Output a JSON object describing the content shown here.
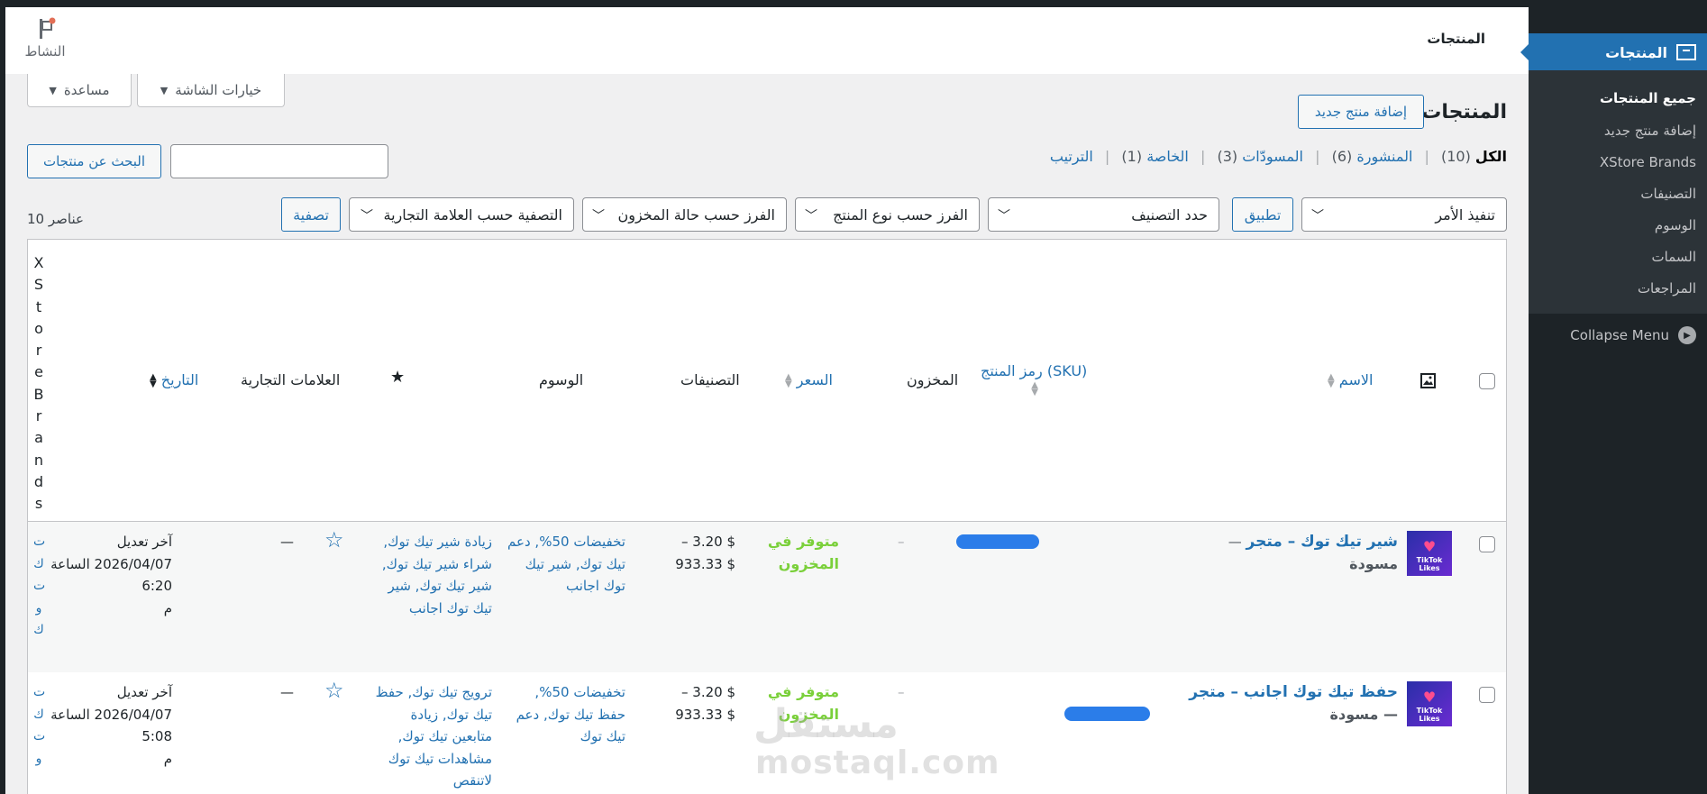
{
  "header": {
    "title": "المنتجات",
    "activity_label": "النشاط"
  },
  "tabs": {
    "screen_options": "خيارات الشاشة",
    "help": "مساعدة"
  },
  "page": {
    "title": "المنتجات",
    "add_new": "إضافة منتج جديد"
  },
  "views": {
    "all": "الكل",
    "all_count": "(10)",
    "published": "المنشورة",
    "published_count": "(6)",
    "drafts": "المسودّات",
    "drafts_count": "(3)",
    "private": "الخاصة",
    "private_count": "(1)",
    "sorting": "الترتيب"
  },
  "search": {
    "button": "البحث عن منتجات",
    "value": ""
  },
  "filters": {
    "bulk_action": "تنفيذ الأمر",
    "apply": "تطبيق",
    "category": "حدد التصنيف",
    "product_type": "الفرز حسب نوع المنتج",
    "stock_status": "الفرز حسب حالة المخزون",
    "brand": "التصفية حسب العلامة التجارية",
    "filter": "تصفية",
    "items_count": "10 عناصر"
  },
  "columns": {
    "image_icon": "image-icon",
    "name": "الاسم",
    "sku": "رمز المنتج (SKU)",
    "stock": "المخزون",
    "price": "السعر",
    "categories": "التصنيفات",
    "tags": "الوسوم",
    "featured_icon": "star-icon",
    "brands": "العلامات التجارية",
    "date": "التاريخ",
    "xstore_brands_vertical": "XStoreBrands"
  },
  "rows": [
    {
      "name": "شير تيك توك – متجر",
      "status": "مسودة",
      "sku": "–",
      "stock": "متوفر في المخزون",
      "price_line1": "$ 3.20 –",
      "price_line2": "$ 933.33",
      "categories": "تخفيضات 50%, دعم تيك توك, شير تيك توك اجانب",
      "tags": "زيادة شير تيك توك, شراء شير تيك توك, شير تيك توك, شير تيك توك اجانب",
      "brands": "—",
      "date_label": "آخر تعديل",
      "date_value": "2026/04/07 الساعة 6:20",
      "date_suffix": "م",
      "thumb_text": "TikTok Likes",
      "vertical_link": "تكتوك"
    },
    {
      "name": "حفظ تيك توك اجانب – متجر",
      "status": "— مسودة",
      "sku": "–",
      "stock": "متوفر في المخزون",
      "price_line1": "$ 3.20 –",
      "price_line2": "$ 933.33",
      "categories": "تخفيضات 50%, حفظ تيك توك, دعم تيك توك",
      "tags": "ترويج تيك توك, حفظ تيك توك, زيادة متابعين تيك توك, مشاهدات تيك توك لاتنقص",
      "brands": "—",
      "date_label": "آخر تعديل",
      "date_value": "2026/04/07 الساعة 5:08",
      "date_suffix": "م",
      "thumb_text": "TikTok Likes",
      "vertical_link": "تكتو"
    }
  ],
  "sidebar": {
    "active": "المنتجات",
    "items": [
      "جميع المنتجات",
      "إضافة منتج جديد",
      "XStore Brands",
      "التصنيفات",
      "الوسوم",
      "السمات",
      "المراجعات"
    ],
    "collapse": "Collapse Menu"
  },
  "watermark": {
    "arabic": "مستقل",
    "latin": "mostaql.com"
  },
  "colors": {
    "accent": "#2271b1",
    "instock": "#7ad03a",
    "sidebar": "#1d2327"
  }
}
